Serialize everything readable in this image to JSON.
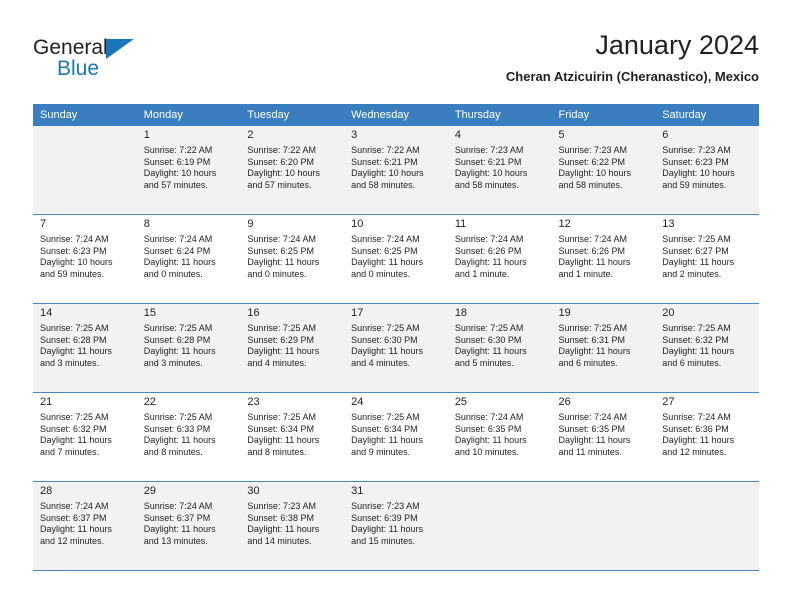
{
  "brand": {
    "word_one": "General",
    "word_two": "Blue",
    "triangle_icon": "triangle-icon"
  },
  "header": {
    "title": "January 2024",
    "subtitle": "Cheran Atzicuirin (Cheranastico), Mexico"
  },
  "colors": {
    "header_row": "#3a7ebf",
    "brand_blue": "#1b75bb",
    "shaded_row": "#f2f2f2",
    "text": "#231f20"
  },
  "weekday_headers": [
    "Sunday",
    "Monday",
    "Tuesday",
    "Wednesday",
    "Thursday",
    "Friday",
    "Saturday"
  ],
  "weeks": [
    {
      "shaded": true,
      "days": [
        {
          "number": "",
          "sunrise": "",
          "sunset": "",
          "daylight_line1": "",
          "daylight_line2": "",
          "empty": true
        },
        {
          "number": "1",
          "sunrise": "Sunrise: 7:22 AM",
          "sunset": "Sunset: 6:19 PM",
          "daylight_line1": "Daylight: 10 hours",
          "daylight_line2": "and 57 minutes."
        },
        {
          "number": "2",
          "sunrise": "Sunrise: 7:22 AM",
          "sunset": "Sunset: 6:20 PM",
          "daylight_line1": "Daylight: 10 hours",
          "daylight_line2": "and 57 minutes."
        },
        {
          "number": "3",
          "sunrise": "Sunrise: 7:22 AM",
          "sunset": "Sunset: 6:21 PM",
          "daylight_line1": "Daylight: 10 hours",
          "daylight_line2": "and 58 minutes."
        },
        {
          "number": "4",
          "sunrise": "Sunrise: 7:23 AM",
          "sunset": "Sunset: 6:21 PM",
          "daylight_line1": "Daylight: 10 hours",
          "daylight_line2": "and 58 minutes."
        },
        {
          "number": "5",
          "sunrise": "Sunrise: 7:23 AM",
          "sunset": "Sunset: 6:22 PM",
          "daylight_line1": "Daylight: 10 hours",
          "daylight_line2": "and 58 minutes."
        },
        {
          "number": "6",
          "sunrise": "Sunrise: 7:23 AM",
          "sunset": "Sunset: 6:23 PM",
          "daylight_line1": "Daylight: 10 hours",
          "daylight_line2": "and 59 minutes."
        }
      ]
    },
    {
      "shaded": false,
      "days": [
        {
          "number": "7",
          "sunrise": "Sunrise: 7:24 AM",
          "sunset": "Sunset: 6:23 PM",
          "daylight_line1": "Daylight: 10 hours",
          "daylight_line2": "and 59 minutes."
        },
        {
          "number": "8",
          "sunrise": "Sunrise: 7:24 AM",
          "sunset": "Sunset: 6:24 PM",
          "daylight_line1": "Daylight: 11 hours",
          "daylight_line2": "and 0 minutes."
        },
        {
          "number": "9",
          "sunrise": "Sunrise: 7:24 AM",
          "sunset": "Sunset: 6:25 PM",
          "daylight_line1": "Daylight: 11 hours",
          "daylight_line2": "and 0 minutes."
        },
        {
          "number": "10",
          "sunrise": "Sunrise: 7:24 AM",
          "sunset": "Sunset: 6:25 PM",
          "daylight_line1": "Daylight: 11 hours",
          "daylight_line2": "and 0 minutes."
        },
        {
          "number": "11",
          "sunrise": "Sunrise: 7:24 AM",
          "sunset": "Sunset: 6:26 PM",
          "daylight_line1": "Daylight: 11 hours",
          "daylight_line2": "and 1 minute."
        },
        {
          "number": "12",
          "sunrise": "Sunrise: 7:24 AM",
          "sunset": "Sunset: 6:26 PM",
          "daylight_line1": "Daylight: 11 hours",
          "daylight_line2": "and 1 minute."
        },
        {
          "number": "13",
          "sunrise": "Sunrise: 7:25 AM",
          "sunset": "Sunset: 6:27 PM",
          "daylight_line1": "Daylight: 11 hours",
          "daylight_line2": "and 2 minutes."
        }
      ]
    },
    {
      "shaded": true,
      "days": [
        {
          "number": "14",
          "sunrise": "Sunrise: 7:25 AM",
          "sunset": "Sunset: 6:28 PM",
          "daylight_line1": "Daylight: 11 hours",
          "daylight_line2": "and 3 minutes."
        },
        {
          "number": "15",
          "sunrise": "Sunrise: 7:25 AM",
          "sunset": "Sunset: 6:28 PM",
          "daylight_line1": "Daylight: 11 hours",
          "daylight_line2": "and 3 minutes."
        },
        {
          "number": "16",
          "sunrise": "Sunrise: 7:25 AM",
          "sunset": "Sunset: 6:29 PM",
          "daylight_line1": "Daylight: 11 hours",
          "daylight_line2": "and 4 minutes."
        },
        {
          "number": "17",
          "sunrise": "Sunrise: 7:25 AM",
          "sunset": "Sunset: 6:30 PM",
          "daylight_line1": "Daylight: 11 hours",
          "daylight_line2": "and 4 minutes."
        },
        {
          "number": "18",
          "sunrise": "Sunrise: 7:25 AM",
          "sunset": "Sunset: 6:30 PM",
          "daylight_line1": "Daylight: 11 hours",
          "daylight_line2": "and 5 minutes."
        },
        {
          "number": "19",
          "sunrise": "Sunrise: 7:25 AM",
          "sunset": "Sunset: 6:31 PM",
          "daylight_line1": "Daylight: 11 hours",
          "daylight_line2": "and 6 minutes."
        },
        {
          "number": "20",
          "sunrise": "Sunrise: 7:25 AM",
          "sunset": "Sunset: 6:32 PM",
          "daylight_line1": "Daylight: 11 hours",
          "daylight_line2": "and 6 minutes."
        }
      ]
    },
    {
      "shaded": false,
      "days": [
        {
          "number": "21",
          "sunrise": "Sunrise: 7:25 AM",
          "sunset": "Sunset: 6:32 PM",
          "daylight_line1": "Daylight: 11 hours",
          "daylight_line2": "and 7 minutes."
        },
        {
          "number": "22",
          "sunrise": "Sunrise: 7:25 AM",
          "sunset": "Sunset: 6:33 PM",
          "daylight_line1": "Daylight: 11 hours",
          "daylight_line2": "and 8 minutes."
        },
        {
          "number": "23",
          "sunrise": "Sunrise: 7:25 AM",
          "sunset": "Sunset: 6:34 PM",
          "daylight_line1": "Daylight: 11 hours",
          "daylight_line2": "and 8 minutes."
        },
        {
          "number": "24",
          "sunrise": "Sunrise: 7:25 AM",
          "sunset": "Sunset: 6:34 PM",
          "daylight_line1": "Daylight: 11 hours",
          "daylight_line2": "and 9 minutes."
        },
        {
          "number": "25",
          "sunrise": "Sunrise: 7:24 AM",
          "sunset": "Sunset: 6:35 PM",
          "daylight_line1": "Daylight: 11 hours",
          "daylight_line2": "and 10 minutes."
        },
        {
          "number": "26",
          "sunrise": "Sunrise: 7:24 AM",
          "sunset": "Sunset: 6:35 PM",
          "daylight_line1": "Daylight: 11 hours",
          "daylight_line2": "and 11 minutes."
        },
        {
          "number": "27",
          "sunrise": "Sunrise: 7:24 AM",
          "sunset": "Sunset: 6:36 PM",
          "daylight_line1": "Daylight: 11 hours",
          "daylight_line2": "and 12 minutes."
        }
      ]
    },
    {
      "shaded": true,
      "days": [
        {
          "number": "28",
          "sunrise": "Sunrise: 7:24 AM",
          "sunset": "Sunset: 6:37 PM",
          "daylight_line1": "Daylight: 11 hours",
          "daylight_line2": "and 12 minutes."
        },
        {
          "number": "29",
          "sunrise": "Sunrise: 7:24 AM",
          "sunset": "Sunset: 6:37 PM",
          "daylight_line1": "Daylight: 11 hours",
          "daylight_line2": "and 13 minutes."
        },
        {
          "number": "30",
          "sunrise": "Sunrise: 7:23 AM",
          "sunset": "Sunset: 6:38 PM",
          "daylight_line1": "Daylight: 11 hours",
          "daylight_line2": "and 14 minutes."
        },
        {
          "number": "31",
          "sunrise": "Sunrise: 7:23 AM",
          "sunset": "Sunset: 6:39 PM",
          "daylight_line1": "Daylight: 11 hours",
          "daylight_line2": "and 15 minutes."
        },
        {
          "number": "",
          "sunrise": "",
          "sunset": "",
          "daylight_line1": "",
          "daylight_line2": "",
          "empty": true
        },
        {
          "number": "",
          "sunrise": "",
          "sunset": "",
          "daylight_line1": "",
          "daylight_line2": "",
          "empty": true
        },
        {
          "number": "",
          "sunrise": "",
          "sunset": "",
          "daylight_line1": "",
          "daylight_line2": "",
          "empty": true
        }
      ]
    }
  ]
}
